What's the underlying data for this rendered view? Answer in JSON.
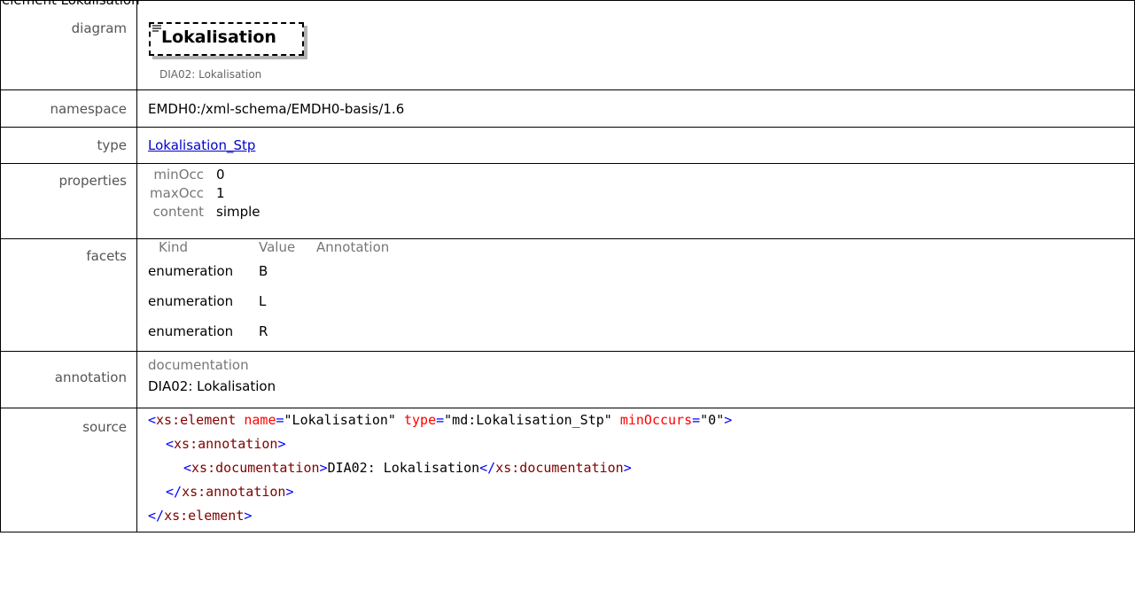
{
  "header_cut": "element  Lokalisation",
  "rows": {
    "diagram": {
      "label": "diagram",
      "element_name": "Lokalisation",
      "element_doc": "DIA02: Lokalisation"
    },
    "namespace": {
      "label": "namespace",
      "value": "EMDH0:/xml-schema/EMDH0-basis/1.6"
    },
    "type": {
      "label": "type",
      "value": "Lokalisation_Stp"
    },
    "properties": {
      "label": "properties",
      "items": [
        {
          "name": "minOcc",
          "value": "0"
        },
        {
          "name": "maxOcc",
          "value": "1"
        },
        {
          "name": "content",
          "value": "simple"
        }
      ]
    },
    "facets": {
      "label": "facets",
      "headers": {
        "kind": "Kind",
        "value": "Value",
        "annotation": "Annotation"
      },
      "items": [
        {
          "kind": "enumeration",
          "value": "B"
        },
        {
          "kind": "enumeration",
          "value": "L"
        },
        {
          "kind": "enumeration",
          "value": "R"
        }
      ]
    },
    "annotation": {
      "label": "annotation",
      "doc_label": "documentation",
      "doc_text": "DIA02: Lokalisation"
    },
    "source": {
      "label": "source",
      "line1": {
        "open": "<",
        "el": "xs:element",
        "a1": "name",
        "v1": "\"Lokalisation\"",
        "a2": "type",
        "v2": "\"md:Lokalisation_Stp\"",
        "a3": "minOccurs",
        "v3": "\"0\"",
        "close": ">"
      },
      "line2": {
        "open": "<",
        "el": "xs:annotation",
        "close": ">"
      },
      "line3": {
        "open": "<",
        "el": "xs:documentation",
        "close": ">",
        "text": "DIA02: Lokalisation",
        "endopen": "</",
        "endel": "xs:documentation",
        "endclose": ">"
      },
      "line4": {
        "open": "</",
        "el": "xs:annotation",
        "close": ">"
      },
      "line5": {
        "open": "</",
        "el": "xs:element",
        "close": ">"
      }
    }
  }
}
